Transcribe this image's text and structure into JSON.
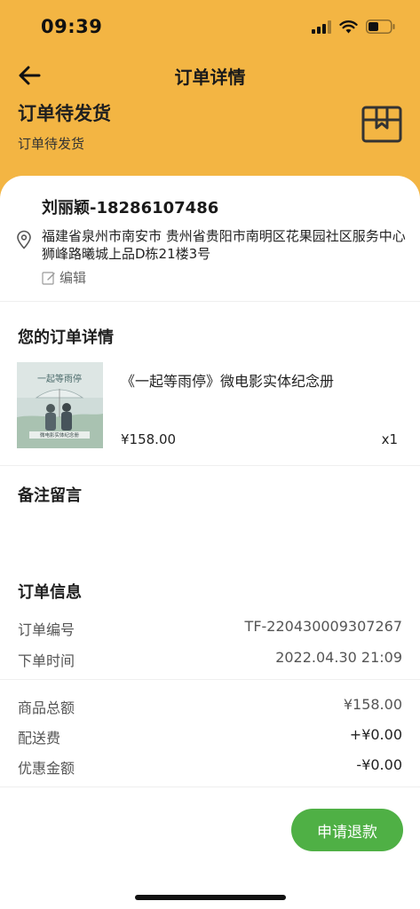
{
  "status_bar": {
    "time": "09:39"
  },
  "nav": {
    "title": "订单详情",
    "back_icon": "arrow-left-icon"
  },
  "order_status": {
    "title": "订单待发货",
    "subtitle": "订单待发货",
    "icon": "package-icon"
  },
  "address": {
    "name_phone": "刘丽颖-18286107486",
    "text": "福建省泉州市南安市 贵州省贵阳市南明区花果园社区服务中心 狮峰路曦城上品D栋21楼3号",
    "edit_label": "编辑"
  },
  "order_details": {
    "title": "您的订单详情",
    "item": {
      "name": "《一起等雨停》微电影实体纪念册",
      "price": "¥158.00",
      "qty": "x1",
      "image_text": "一起等雨停",
      "image_caption": "微电影实体纪念册"
    }
  },
  "remark": {
    "title": "备注留言"
  },
  "order_info": {
    "title": "订单信息",
    "rows": [
      {
        "label": "订单编号",
        "value": "TF-220430009307267"
      },
      {
        "label": "下单时间",
        "value": "2022.04.30 21:09"
      }
    ]
  },
  "amounts": [
    {
      "label": "商品总额",
      "value": "¥158.00"
    },
    {
      "label": "配送费",
      "value": "+¥0.00"
    },
    {
      "label": "优惠金额",
      "value": "-¥0.00"
    }
  ],
  "actions": {
    "refund_label": "申请退款"
  },
  "colors": {
    "header": "#F3B543",
    "accent_green": "#4FB045"
  }
}
